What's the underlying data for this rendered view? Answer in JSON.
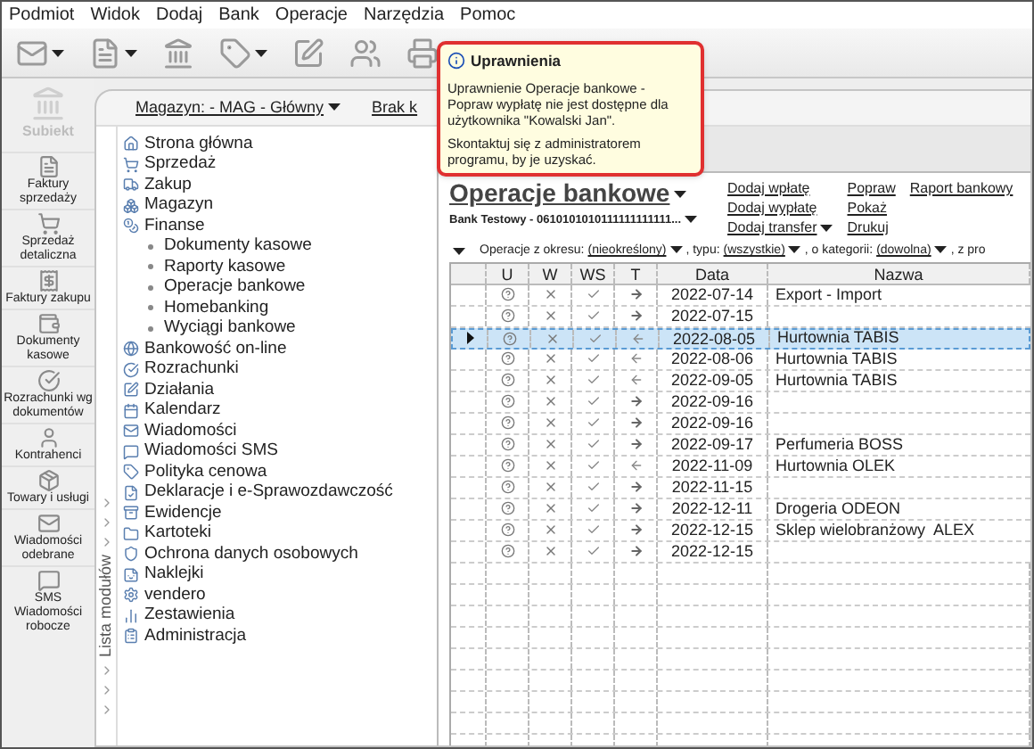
{
  "menu": [
    "Podmiot",
    "Widok",
    "Dodaj",
    "Bank",
    "Operacje",
    "Narzędzia",
    "Pomoc"
  ],
  "toolbar": [
    {
      "dropdown": true
    },
    {
      "dropdown": true
    },
    {
      "dropdown": false
    },
    {
      "dropdown": true
    },
    {
      "dropdown": false
    },
    {
      "dropdown": false
    },
    {
      "dropdown": false
    }
  ],
  "sidebar": {
    "logo": "Subiekt",
    "items": [
      {
        "label": "Faktury sprzedaży"
      },
      {
        "label": "Sprzedaż detaliczna"
      },
      {
        "label": "Faktury zakupu"
      },
      {
        "label": "Dokumenty kasowe"
      },
      {
        "label": "Rozrachunki wg dokumentów"
      },
      {
        "label": "Kontrahenci"
      },
      {
        "label": "Towary i usługi"
      },
      {
        "label": "Wiadomości odebrane"
      },
      {
        "label": "SMS Wiadomości robocze"
      }
    ]
  },
  "header": {
    "warehouse": "Magazyn: - MAG - Główny",
    "other": "Brak k"
  },
  "modules": {
    "label": "Lista modułów",
    "items": [
      {
        "label": "Strona główna"
      },
      {
        "label": "Sprzedaż"
      },
      {
        "label": "Zakup"
      },
      {
        "label": "Magazyn"
      },
      {
        "label": "Finanse",
        "children": [
          {
            "label": "Dokumenty kasowe"
          },
          {
            "label": "Raporty kasowe"
          },
          {
            "label": "Operacje bankowe"
          },
          {
            "label": "Homebanking"
          },
          {
            "label": "Wyciągi bankowe"
          }
        ]
      },
      {
        "label": "Bankowość on-line"
      },
      {
        "label": "Rozrachunki"
      },
      {
        "label": "Działania"
      },
      {
        "label": "Kalendarz"
      },
      {
        "label": "Wiadomości"
      },
      {
        "label": "Wiadomości SMS"
      },
      {
        "label": "Polityka cenowa"
      },
      {
        "label": "Deklaracje i e-Sprawozdawczość"
      },
      {
        "label": "Ewidencje"
      },
      {
        "label": "Kartoteki"
      },
      {
        "label": "Ochrona danych osobowych"
      },
      {
        "label": "Naklejki"
      },
      {
        "label": "vendero"
      },
      {
        "label": "Zestawienia"
      },
      {
        "label": "Administracja"
      }
    ]
  },
  "content": {
    "title": "Operacje bankowe",
    "account": "Bank Testowy - 0610101010111111111111...",
    "link_columns": [
      [
        {
          "label": "Dodaj wpłatę",
          "dropdown": false
        },
        {
          "label": "Dodaj wypłatę",
          "dropdown": false
        },
        {
          "label": "Dodaj transfer",
          "dropdown": true
        }
      ],
      [
        {
          "label": "Popraw",
          "dropdown": false
        },
        {
          "label": "Pokaż",
          "dropdown": false
        },
        {
          "label": "Drukuj",
          "dropdown": false
        }
      ],
      [
        {
          "label": "Raport bankowy",
          "dropdown": false
        }
      ]
    ],
    "filters": [
      {
        "label": "Operacje z okresu:",
        "value": "(nieokreślony)"
      },
      {
        "label": ", typu:",
        "value": "(wszystkie)"
      },
      {
        "label": ", o kategorii:",
        "value": "(dowolna)"
      },
      {
        "label": ", z pro"
      }
    ]
  },
  "table": {
    "columns": [
      "U",
      "W",
      "WS",
      "T",
      "Data",
      "Nazwa"
    ],
    "rows": [
      {
        "date": "2022-07-14",
        "name": "Export - Import",
        "kind": "out",
        "selected": false
      },
      {
        "date": "2022-07-15",
        "kind": "out",
        "selected": false
      },
      {
        "date": "2022-08-05",
        "name": "Hurtownia TABIS",
        "kind": "in",
        "selected": true
      },
      {
        "date": "2022-08-06",
        "name": "Hurtownia TABIS",
        "kind": "in",
        "selected": false
      },
      {
        "date": "2022-09-05",
        "name": "Hurtownia TABIS",
        "kind": "in",
        "selected": false
      },
      {
        "date": "2022-09-16",
        "kind": "out",
        "selected": false
      },
      {
        "date": "2022-09-16",
        "kind": "out",
        "selected": false
      },
      {
        "date": "2022-09-17",
        "name": "Perfumeria BOSS",
        "kind": "out",
        "selected": false
      },
      {
        "date": "2022-11-09",
        "name": "Hurtownia OLEK",
        "kind": "in",
        "selected": false
      },
      {
        "date": "2022-11-15",
        "kind": "out",
        "selected": false
      },
      {
        "date": "2022-12-11",
        "name": "Drogeria ODEON",
        "kind": "out",
        "selected": false
      },
      {
        "date": "2022-12-15",
        "name": "Sklep wielobranżowy  ALEX",
        "kind": "out",
        "selected": false
      },
      {
        "date": "2022-12-15",
        "kind": "out",
        "selected": false
      }
    ]
  },
  "tooltip": {
    "title": "Uprawnienia",
    "paragraphs": [
      "Uprawnienie Operacje bankowe - Popraw wypłatę nie jest dostępne dla użytkownika \"Kowalski Jan\".",
      "Skontaktuj się z administratorem programu, by je uzyskać."
    ]
  }
}
